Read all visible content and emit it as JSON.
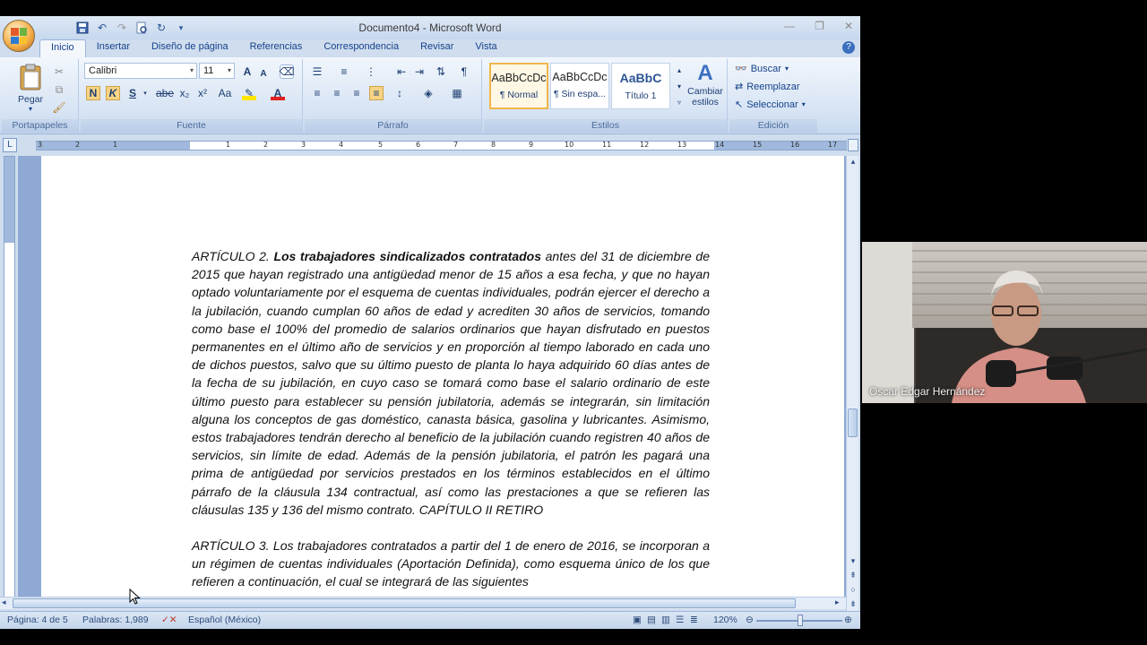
{
  "window": {
    "title": "Documento4 - Microsoft Word",
    "controls": [
      "minimize",
      "restore",
      "close"
    ]
  },
  "quick_access": [
    "save-icon",
    "undo-icon",
    "redo-icon",
    "print-preview-icon",
    "refresh-icon",
    "customize-icon"
  ],
  "tabs": [
    {
      "label": "Inicio",
      "active": true
    },
    {
      "label": "Insertar"
    },
    {
      "label": "Diseño de página"
    },
    {
      "label": "Referencias"
    },
    {
      "label": "Correspondencia"
    },
    {
      "label": "Revisar"
    },
    {
      "label": "Vista"
    }
  ],
  "ribbon": {
    "clipboard": {
      "paste_label": "Pegar",
      "group_label": "Portapapeles"
    },
    "font": {
      "font_name": "Calibri",
      "font_size": "11",
      "group_label": "Fuente",
      "bold": "N",
      "italic": "K",
      "underline": "S",
      "strike": "abe",
      "subscript": "x₂",
      "superscript": "x²",
      "case": "Aa",
      "grow": "A",
      "shrink": "A",
      "font_color_label": "A"
    },
    "paragraph": {
      "group_label": "Párrafo"
    },
    "styles": {
      "group_label": "Estilos",
      "items": [
        {
          "sample": "AaBbCcDc",
          "name": "¶ Normal",
          "selected": true
        },
        {
          "sample": "AaBbCcDc",
          "name": "¶ Sin espa..."
        },
        {
          "sample": "AaBbC",
          "name": "Título 1"
        }
      ],
      "change_styles_label": "Cambiar estilos"
    },
    "editing": {
      "group_label": "Edición",
      "find": "Buscar",
      "replace": "Reemplazar",
      "select": "Seleccionar"
    }
  },
  "ruler": {
    "ticks": [
      "3",
      "2",
      "1",
      "1",
      "2",
      "3",
      "4",
      "5",
      "6",
      "7",
      "8",
      "9",
      "10",
      "11",
      "12",
      "13",
      "14",
      "15",
      "16",
      "17",
      "18"
    ]
  },
  "document": {
    "article2_lead": "ARTÍCULO 2. ",
    "article2_bold": "Los trabajadores sindicalizados contratados",
    "article2_body": " antes del 31 de diciembre de 2015 que hayan registrado una antigüedad menor de 15 años a esa fecha, y que no hayan optado voluntariamente por el esquema de cuentas individuales, podrán ejercer el derecho a la jubilación, cuando cumplan 60 años de edad y acrediten 30 años de servicios, tomando como base el 100% del promedio de salarios ordinarios que hayan disfrutado en puestos permanentes en el último año de servicios y en proporción al tiempo laborado en cada uno de dichos puestos, salvo que su último puesto de planta lo haya adquirido 60 días antes de la fecha de su jubilación, en cuyo caso se tomará como base el salario ordinario de este último puesto para establecer su pensión jubilatoria, además se integrarán, sin limitación alguna los conceptos de gas doméstico, canasta básica, gasolina y lubricantes. Asimismo, estos trabajadores tendrán derecho al beneficio de la jubilación cuando registren 40 años de servicios, sin límite de edad. Además de la pensión jubilatoria, el patrón les pagará una prima de antigüedad por servicios prestados en los términos establecidos en el último párrafo de la cláusula 134 contractual, así como las prestaciones a que se refieren las cláusulas 135 y 136 del mismo contrato. CAPÍTULO II RETIRO",
    "article3": "ARTÍCULO 3. Los trabajadores contratados a partir del 1 de enero de 2016, se incorporan a un régimen de cuentas individuales (Aportación Definida), como esquema único de los que refieren a continuación, el cual se integrará de las siguientes"
  },
  "status": {
    "page": "Página: 4 de 5",
    "words": "Palabras: 1,989",
    "language": "Español (México)",
    "zoom": "120%"
  },
  "webcam": {
    "name": "Oscar Edgar Hernández"
  },
  "colors": {
    "ribbon_text": "#15428b",
    "selected_style": "#f2b64a",
    "workspace": "#8eaad4"
  }
}
